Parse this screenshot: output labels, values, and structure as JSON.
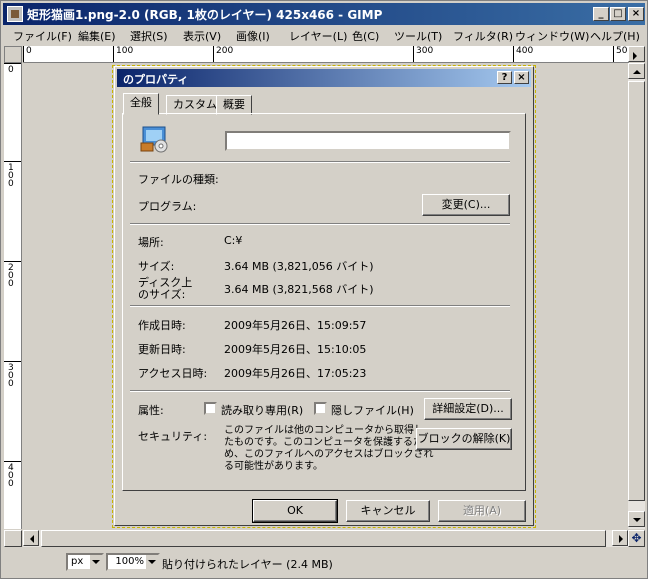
{
  "window": {
    "title": "矩形猫画1.png-2.0 (RGB, 1枚のレイヤー) 425x466 - GIMP",
    "minimize": "_",
    "maximize": "□",
    "close": "×"
  },
  "menubar": [
    "ファイル(F)",
    "編集(E)",
    "選択(S)",
    "表示(V)",
    "画像(I)",
    "レイヤー(L)",
    "色(C)",
    "ツール(T)",
    "フィルタ(R)",
    "ウィンドウ(W)",
    "ヘルプ(H)"
  ],
  "ruler": {
    "h_labels": [
      "0",
      "100",
      "200",
      "300",
      "400",
      "50"
    ],
    "v_labels": [
      "0",
      "100",
      "200",
      "300",
      "400"
    ]
  },
  "dialog": {
    "title": "のプロパティ",
    "help_btn": "?",
    "close_btn": "×",
    "tabs": [
      "全般",
      "カスタム",
      "概要"
    ],
    "name_value": "",
    "file_type_label": "ファイルの種類:",
    "program_label": "プログラム:",
    "change_button": "変更(C)...",
    "location_label": "場所:",
    "location_value": "C:¥",
    "size_label": "サイズ:",
    "size_value": "3.64 MB (3,821,056 バイト)",
    "disk_size_label_1": "ディスク上",
    "disk_size_label_2": "のサイズ:",
    "disk_size_value": "3.64 MB (3,821,568 バイト)",
    "created_label": "作成日時:",
    "created_value": "2009年5月26日、15:09:57",
    "modified_label": "更新日時:",
    "modified_value": "2009年5月26日、15:10:05",
    "accessed_label": "アクセス日時:",
    "accessed_value": "2009年5月26日、17:05:23",
    "attributes_label": "属性:",
    "readonly_label": "読み取り専用(R)",
    "hidden_label": "隠しファイル(H)",
    "advanced_button": "詳細設定(D)...",
    "security_label": "セキュリティ:",
    "security_text": [
      "このファイルは他のコンピュータから取得し",
      "たものです。このコンピュータを保護するた",
      "め、このファイルへのアクセスはブロックされ",
      "る可能性があります。"
    ],
    "unblock_button": "ブロックの解除(K)",
    "ok_button": "OK",
    "cancel_button": "キャンセル",
    "apply_button": "適用(A)"
  },
  "status": {
    "unit": "px",
    "zoom": "100%",
    "message": "貼り付けられたレイヤー (2.4 MB)"
  }
}
